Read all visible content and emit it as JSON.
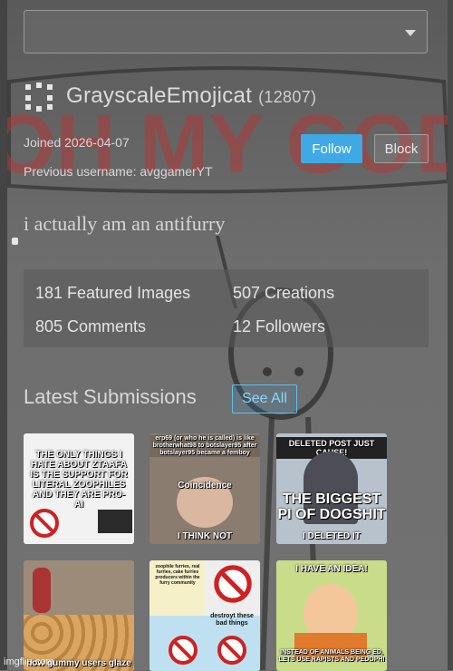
{
  "profile": {
    "username": "GrayscaleEmojicat",
    "points": "(12807)",
    "joined": "Joined 2026-04-07",
    "previous_username": "Previous username: avggamerYT",
    "bio": "i actually am an antifurry"
  },
  "actions": {
    "follow_label": "Follow",
    "block_label": "Block"
  },
  "stats": {
    "featured": "181 Featured Images",
    "creations": "507 Creations",
    "comments": "805 Comments",
    "followers": "12 Followers"
  },
  "latest": {
    "title": "Latest Submissions",
    "see_all_label": "See All"
  },
  "background_text": "OH MY GOD BRUH",
  "thumbnails": [
    {
      "caption_top": "THE ONLY THINGS I HATE ABOUT ZTAAFA IS THE SUPPORT FOR LITERAL ZOOPHILES AND THEY ARE PRO-AI",
      "caption_bottom": ""
    },
    {
      "caption_top": "erp69 (or who he is called) is like brotherwhat98 to botslayer95 after botslayer95 became a femboy",
      "caption_mid": "Coincidence",
      "caption_bottom": "I THINK NOT"
    },
    {
      "caption_top": "DELETED POST JUST CAUSE!",
      "caption_mid": "THE BIGGEST PI OF DOGSHIT",
      "caption_bottom": "I DELETED IT"
    },
    {
      "caption_top": "",
      "caption_bottom": "how gummy users glaze"
    },
    {
      "caption_top": "zoophile furries, real furries, cake furries producers within the furry community",
      "caption_mid": "destroyt these bad things",
      "caption_bottom": ""
    },
    {
      "caption_top": "I HAVE AN IDEA!",
      "caption_bottom": "INSTEAD OF ANIMALS BEING ED, LETS USE RAPISTS AND PEDOPHI"
    }
  ],
  "watermark": "imgflip.com",
  "colors": {
    "follow_bg": "#3fa9e6",
    "see_all_border": "#5fc0f0",
    "bg_text": "#b03a3a"
  }
}
